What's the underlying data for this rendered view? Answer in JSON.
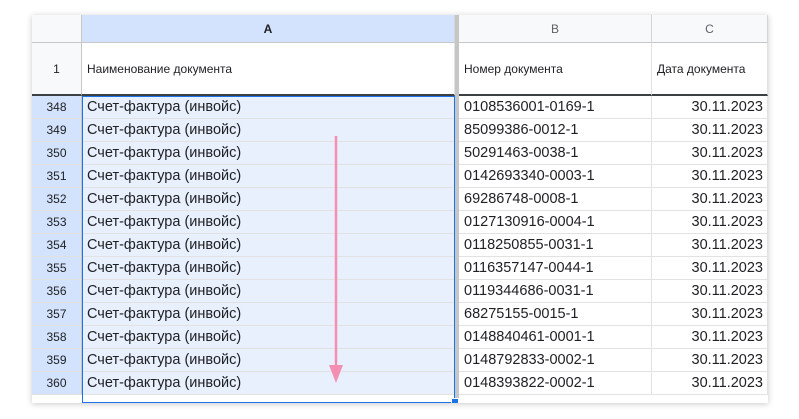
{
  "columns": [
    "A",
    "B",
    "C"
  ],
  "header_row": {
    "row_number": "1",
    "cells": [
      "Наименование документа",
      "Номер документа",
      "Дата документа"
    ]
  },
  "selection": {
    "column": "A",
    "first_row": "348",
    "last_row": "360"
  },
  "drag_arrow": {
    "color": "#f48fb1",
    "direction": "down"
  },
  "rows": [
    {
      "n": "348",
      "a": "Счет-фактура (инвойс)",
      "b": "0108536001-0169-1",
      "c": "30.11.2023"
    },
    {
      "n": "349",
      "a": "Счет-фактура (инвойс)",
      "b": "85099386-0012-1",
      "c": "30.11.2023"
    },
    {
      "n": "350",
      "a": "Счет-фактура (инвойс)",
      "b": "50291463-0038-1",
      "c": "30.11.2023"
    },
    {
      "n": "351",
      "a": "Счет-фактура (инвойс)",
      "b": "0142693340-0003-1",
      "c": "30.11.2023"
    },
    {
      "n": "352",
      "a": "Счет-фактура (инвойс)",
      "b": "69286748-0008-1",
      "c": "30.11.2023"
    },
    {
      "n": "353",
      "a": "Счет-фактура (инвойс)",
      "b": "0127130916-0004-1",
      "c": "30.11.2023"
    },
    {
      "n": "354",
      "a": "Счет-фактура (инвойс)",
      "b": "0118250855-0031-1",
      "c": "30.11.2023"
    },
    {
      "n": "355",
      "a": "Счет-фактура (инвойс)",
      "b": "0116357147-0044-1",
      "c": "30.11.2023"
    },
    {
      "n": "356",
      "a": "Счет-фактура (инвойс)",
      "b": "0119344686-0031-1",
      "c": "30.11.2023"
    },
    {
      "n": "357",
      "a": "Счет-фактура (инвойс)",
      "b": "68275155-0015-1",
      "c": "30.11.2023"
    },
    {
      "n": "358",
      "a": "Счет-фактура (инвойс)",
      "b": "0148840461-0001-1",
      "c": "30.11.2023"
    },
    {
      "n": "359",
      "a": "Счет-фактура (инвойс)",
      "b": "0148792833-0002-1",
      "c": "30.11.2023"
    },
    {
      "n": "360",
      "a": "Счет-фактура (инвойс)",
      "b": "0148393822-0002-1",
      "c": "30.11.2023"
    }
  ]
}
